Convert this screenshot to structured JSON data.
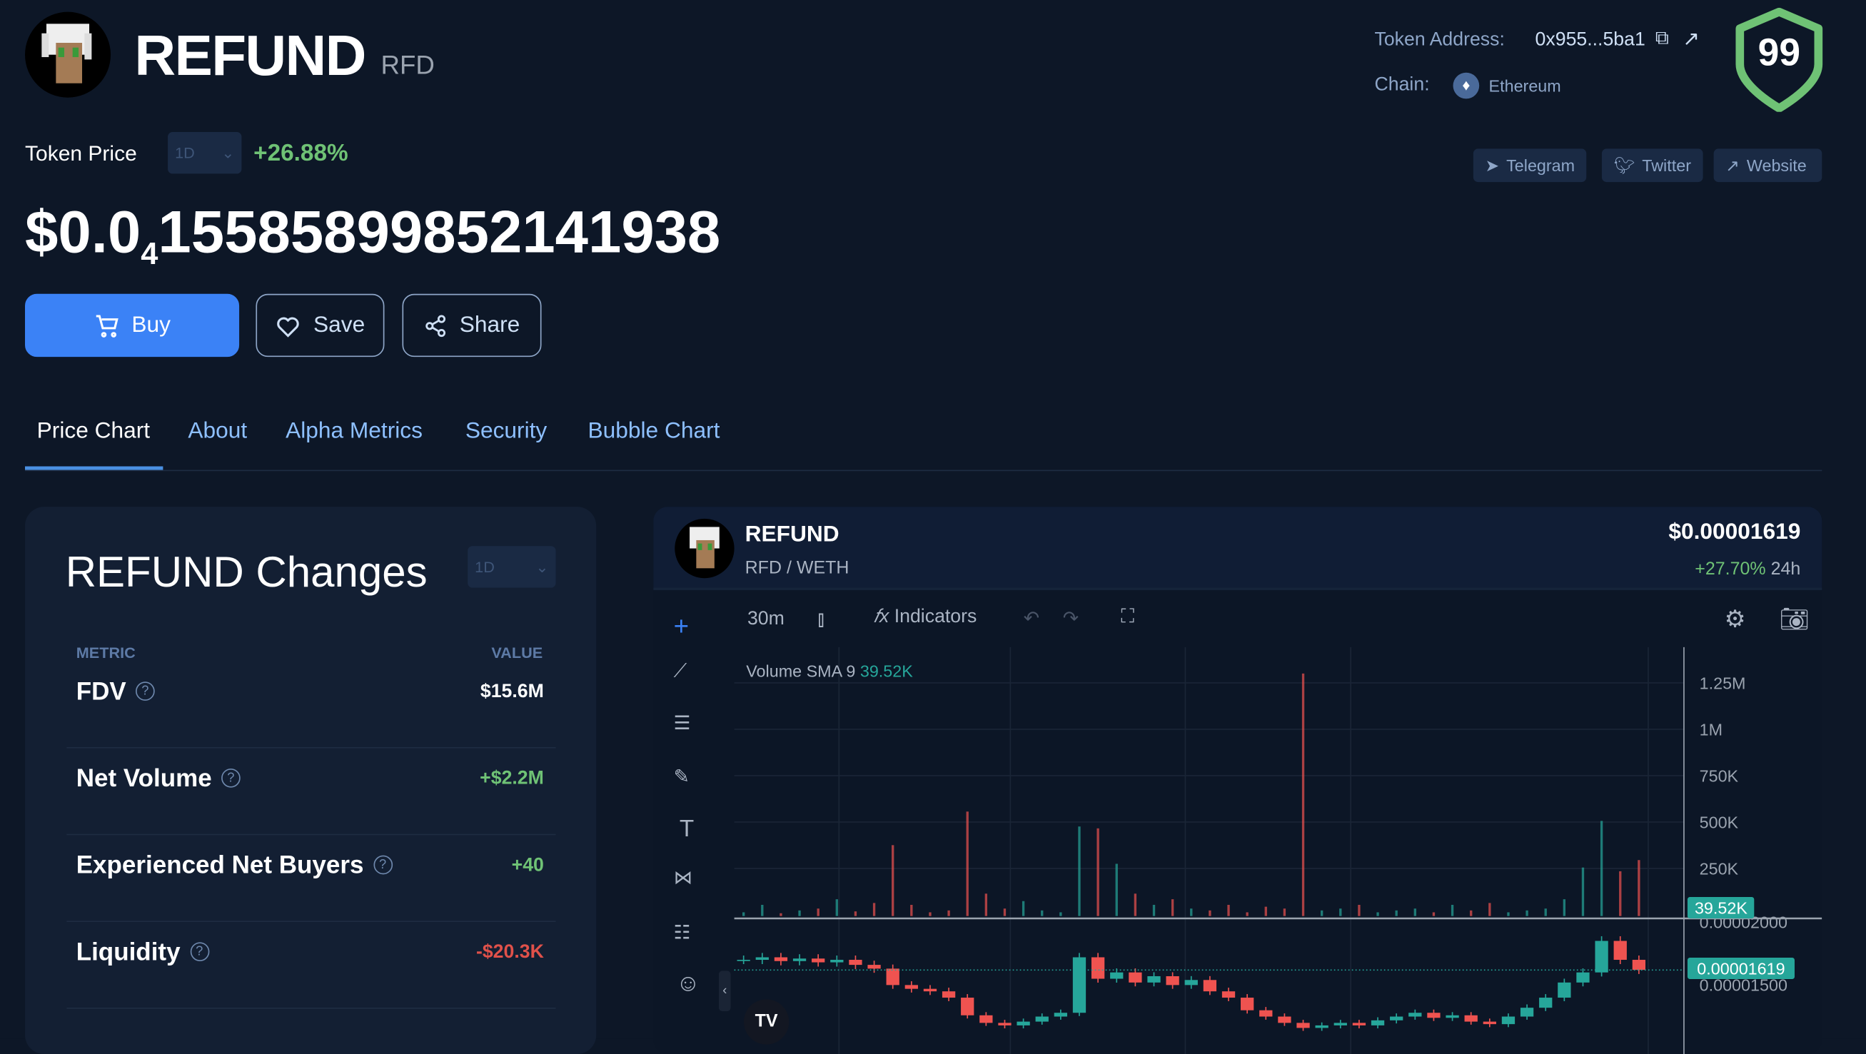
{
  "token": {
    "name": "REFUND",
    "symbol": "RFD",
    "price_label": "Token Price",
    "period": "1D",
    "change": "+26.88%",
    "price_prefix": "$0.0",
    "price_zeros": "4",
    "price_digits": "155858998521419 38"
  },
  "info": {
    "address_label": "Token Address:",
    "address": "0x955...5ba1",
    "chain_label": "Chain:",
    "chain": "Ethereum",
    "score": "99"
  },
  "social": {
    "telegram": "Telegram",
    "twitter": "Twitter",
    "website": "Website"
  },
  "actions": {
    "buy": "Buy",
    "save": "Save",
    "share": "Share"
  },
  "tabs": [
    "Price Chart",
    "About",
    "Alpha Metrics",
    "Security",
    "Bubble Chart"
  ],
  "changes": {
    "title": "REFUND Changes",
    "period": "1D",
    "col_metric": "METRIC",
    "col_value": "VALUE",
    "rows": [
      {
        "name": "FDV",
        "value": "$15.6M"
      },
      {
        "name": "Net Volume",
        "value": "+$2.2M"
      },
      {
        "name": "Experienced Net Buyers",
        "value": "+40"
      },
      {
        "name": "Liquidity",
        "value": "-$20.3K"
      }
    ]
  },
  "chart": {
    "name": "REFUND",
    "pair": "RFD / WETH",
    "price": "$0.00001619",
    "change": "+27.70%",
    "change_period": "24h",
    "interval": "30m",
    "indicators": "Indicators",
    "volume_label": "Volume SMA 9",
    "volume_sma": "39.52K",
    "current_price_tag": "0.00001619",
    "volume_ticks": [
      "1.25M",
      "1M",
      "750K",
      "500K",
      "250K"
    ],
    "price_ticks": [
      "0.00002000",
      "0.00001500"
    ],
    "colors": {
      "up": "#26a69a",
      "down": "#ef5350"
    },
    "closes": [
      1.7e-05,
      1.72e-05,
      1.69e-05,
      1.71e-05,
      1.68e-05,
      1.7e-05,
      1.66e-05,
      1.63e-05,
      1.5e-05,
      1.47e-05,
      1.45e-05,
      1.4e-05,
      1.26e-05,
      1.2e-05,
      1.18e-05,
      1.21e-05,
      1.25e-05,
      1.28e-05,
      1.72e-05,
      1.55e-05,
      1.6e-05,
      1.52e-05,
      1.57e-05,
      1.5e-05,
      1.54e-05,
      1.45e-05,
      1.4e-05,
      1.3e-05,
      1.25e-05,
      1.2e-05,
      1.16e-05,
      1.18e-05,
      1.2e-05,
      1.18e-05,
      1.22e-05,
      1.25e-05,
      1.28e-05,
      1.24e-05,
      1.26e-05,
      1.21e-05,
      1.19e-05,
      1.25e-05,
      1.32e-05,
      1.4e-05,
      1.52e-05,
      1.6e-05,
      1.85e-05,
      1.7e-05,
      1.62e-05
    ],
    "volumes": [
      20,
      60,
      15,
      30,
      40,
      90,
      25,
      70,
      380,
      60,
      20,
      30,
      560,
      120,
      40,
      80,
      30,
      20,
      480,
      470,
      280,
      120,
      60,
      90,
      40,
      30,
      60,
      20,
      50,
      40,
      1300,
      30,
      40,
      60,
      20,
      30,
      40,
      20,
      60,
      30,
      70,
      20,
      30,
      40,
      90,
      260,
      510,
      240,
      300
    ]
  }
}
